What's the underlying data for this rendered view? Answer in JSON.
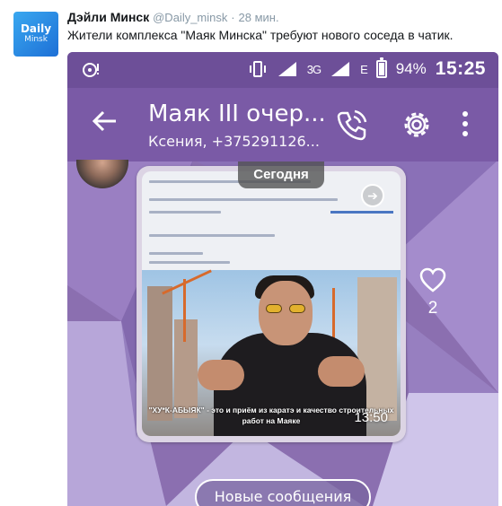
{
  "tweet": {
    "avatar_line1": "Daily",
    "avatar_line2": "Minsk",
    "author_name": "Дэйли Минск",
    "author_handle": "@Daily_minsk",
    "separator": "·",
    "time": "28 мин.",
    "text": "Жители комплекса \"Маяк Минска\" требуют нового соседа в чатик."
  },
  "phone": {
    "status": {
      "battery_percent": "94%",
      "time": "15:25",
      "network_label": "3G",
      "network_label_2": "E"
    },
    "appbar": {
      "chat_title": "Маяк III очер...",
      "chat_subtitle": "Ксения, +375291126..."
    },
    "date_divider": "Сегодня",
    "message": {
      "image_caption": "\"ХУ*К-АБЫЯК\" - это и приём из каратэ и качество строительных работ на Маяке",
      "time": "13:50",
      "likes": "2"
    },
    "new_messages_button": "Новые сообщения"
  },
  "colors": {
    "status_bar": "#6d4f98",
    "app_bar": "#7a5aa6",
    "chat_background": "#8b6fb0",
    "tweet_meta": "#8899a6"
  }
}
